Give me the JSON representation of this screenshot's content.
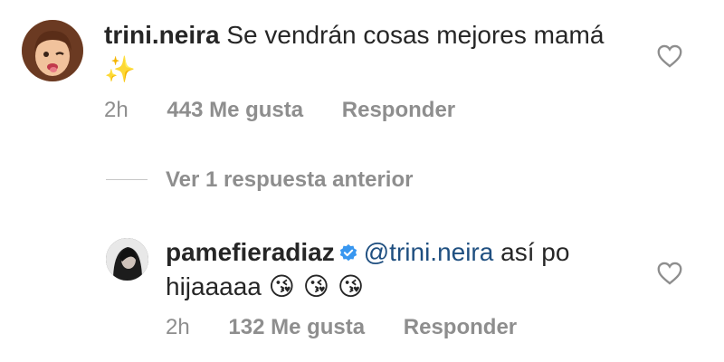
{
  "comment1": {
    "username": "trini.neira",
    "text": "Se vendrán cosas mejores mamá",
    "emoji": "✨",
    "time": "2h",
    "likes": "443 Me gusta",
    "reply": "Responder",
    "avatar_icon": "memoji-avatar"
  },
  "replies_toggle": {
    "label": "Ver 1 respuesta anterior"
  },
  "comment2": {
    "username": "pamefieradiaz",
    "mention": "@trini.neira",
    "text": "así po hijaaaaa",
    "emojis": "😘 😘 😘",
    "time": "2h",
    "likes": "132 Me gusta",
    "reply": "Responder",
    "verified_icon": "verified-badge-icon"
  },
  "colors": {
    "text": "#262626",
    "meta": "#8e8e8e",
    "mention": "#1f4f80",
    "verified": "#3897f0"
  }
}
